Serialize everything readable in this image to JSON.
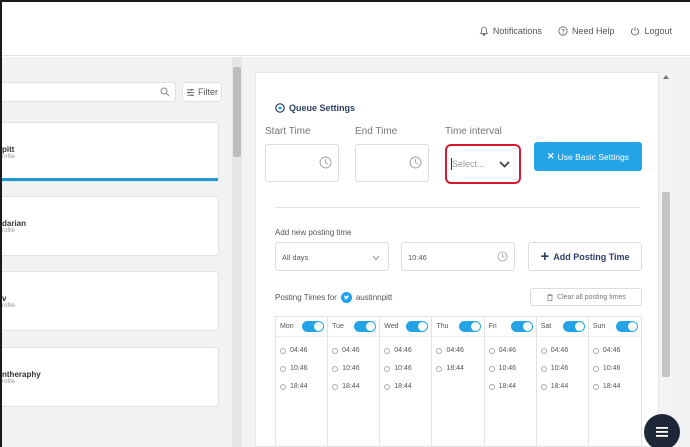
{
  "topnav": {
    "notifications": "Notifications",
    "help": "Need Help",
    "logout": "Logout"
  },
  "sidebar": {
    "filter_label": "Filter",
    "profiles": [
      {
        "name": "pitt",
        "sub": "rofile"
      },
      {
        "name": "darian",
        "sub": "rofile"
      },
      {
        "name": "v",
        "sub": "rofile"
      },
      {
        "name": "ntheraphy",
        "sub": "rofile"
      }
    ]
  },
  "queue": {
    "title": "Queue Settings",
    "start_label": "Start Time",
    "end_label": "End Time",
    "interval_label": "Time interval",
    "interval_placeholder": "Select...",
    "basic_button": "Use Basic Settings"
  },
  "add_posting": {
    "label": "Add new posting time",
    "days_value": "All days",
    "time_value": "10:46",
    "button": "Add Posting Time"
  },
  "posting_times": {
    "label": "Posting Times for",
    "account": "austinnpitt",
    "clear_button": "Clear all posting times",
    "days": [
      {
        "name": "Mon",
        "times": [
          "04:46",
          "10:46",
          "18:44"
        ]
      },
      {
        "name": "Tue",
        "times": [
          "04:46",
          "10:46",
          "18:44"
        ]
      },
      {
        "name": "Wed",
        "times": [
          "04:46",
          "10:46",
          "18:44"
        ]
      },
      {
        "name": "Thu",
        "times": [
          "04:46",
          "18:44"
        ]
      },
      {
        "name": "Fri",
        "times": [
          "04:46",
          "10:46",
          "18:44"
        ]
      },
      {
        "name": "Sat",
        "times": [
          "04:46",
          "10:46",
          "18:44"
        ]
      },
      {
        "name": "Sun",
        "times": [
          "04:46",
          "10:46",
          "18:44"
        ]
      }
    ]
  },
  "colors": {
    "accent": "#24a4e6",
    "navy": "#2d3f63",
    "highlight": "#d6192c"
  }
}
